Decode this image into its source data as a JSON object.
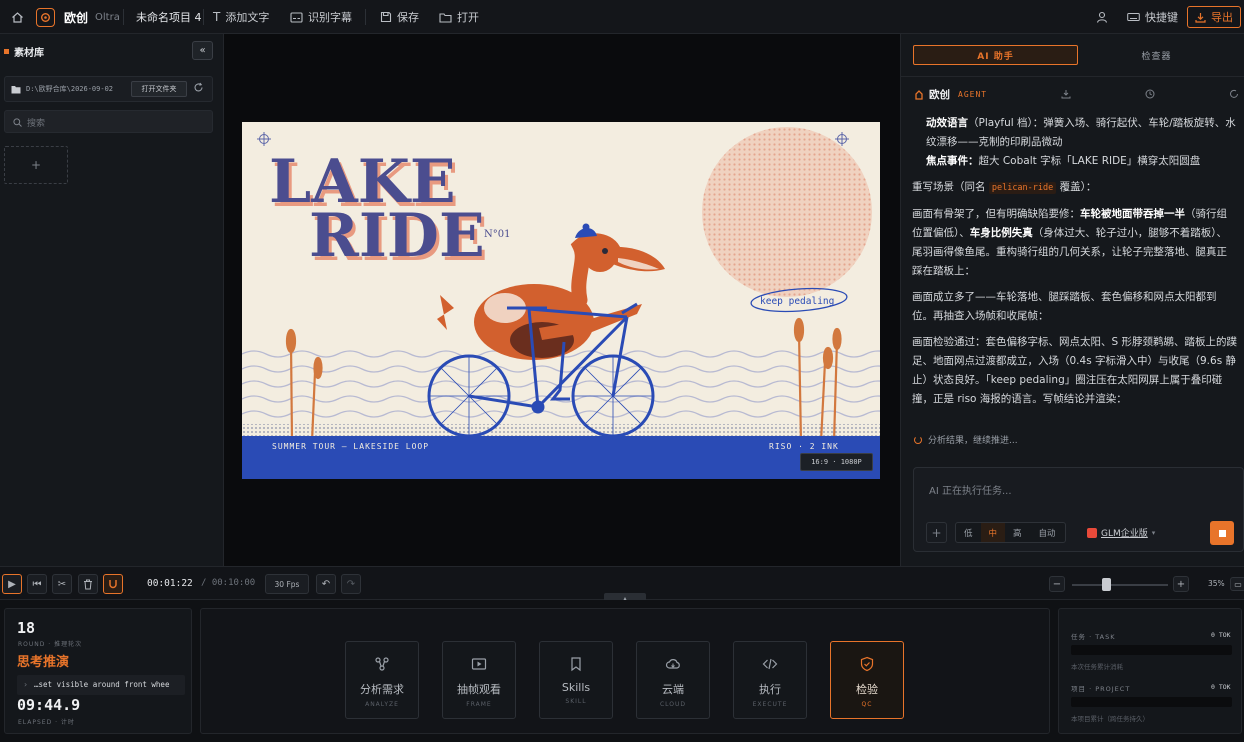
{
  "topbar": {
    "brand": "欧创",
    "brand_sub": "Oltra",
    "project": "未命名项目 4",
    "add_text": "添加文字",
    "subtitle": "识别字幕",
    "save": "保存",
    "open": "打开",
    "shortcuts": "快捷键",
    "export": "导出"
  },
  "library": {
    "title": "素材库",
    "path": "D:\\欧野合库\\2026-09-02",
    "open_folder": "打开文件夹",
    "search_placeholder": "搜索"
  },
  "poster": {
    "title_line1": "LAKE",
    "title_line2": "RIDE",
    "number": "N°01",
    "tag": "keep pedaling",
    "footer_left": "SUMMER TOUR — LAKESIDE LOOP",
    "footer_right": "RISO · 2 INK",
    "ratio": "16:9 · 1080P"
  },
  "assistant": {
    "tab_ai": "AI 助手",
    "tab_review": "检查器",
    "agent_name": "欧创",
    "agent_tag": "AGENT",
    "line1_label": "动效语言",
    "line1_text": "（Playful 档）：弹簧入场、骑行起伏、车轮/踏板旋转、水纹漂移——克制的印刷品微动",
    "line2_label": "焦点事件：",
    "line2_text": "超大 Cobalt 字标「LAKE RIDE」横穿太阳圆盘",
    "rewrite_pre": "重写场景（同名",
    "rewrite_code": "pelican-ride",
    "rewrite_post": "覆盖）：",
    "p2_a": "画面有骨架了，但有明确缺陷要修：",
    "p2_b": "车轮被地面带吞掉一半",
    "p2_c": "（骑行组位置偏低）、",
    "p2_d": "车身比例失真",
    "p2_e": "（身体过大、轮子过小，腿够不着踏板）、尾羽画得像鱼尾。重构骑行组的几何关系，让轮子完整落地、腿真正踩在踏板上：",
    "p3": "画面成立多了——车轮落地、腿踩踏板、套色偏移和网点太阳都到位。再抽查入场帧和收尾帧：",
    "p4": "画面检验通过：套色偏移字标、网点太阳、S 形脖颈鹈鹕、踏板上的蹼足、地面网点过渡都成立，入场（0.4s 字标滑入中）与收尾（9.6s 静止）状态良好。「keep pedaling」圈注压在太阳网屏上属于叠印碰撞，正是 riso 海报的语言。写帧结论并渲染：",
    "status": "分析结果，继续推进...",
    "input_placeholder": "AI 正在执行任务...",
    "levels": [
      "低",
      "中",
      "高",
      "自动"
    ],
    "level_selected": "中",
    "model": "GLM企业版"
  },
  "timeline": {
    "time_current": "00:01:22",
    "time_total": "/ 00:10:00",
    "fps": "30 Fps",
    "zoom": "35%"
  },
  "status_panel": {
    "round": "18",
    "round_label": "ROUND · 推理轮次",
    "title": "思考推演",
    "snippet": "…set visible around front whee",
    "elapsed": "09:44.9",
    "elapsed_label": "ELAPSED · 计时"
  },
  "workflow": [
    {
      "label": "分析需求",
      "sub": "ANALYZE"
    },
    {
      "label": "抽帧观看",
      "sub": "FRAME"
    },
    {
      "label": "Skills",
      "sub": "SKILL"
    },
    {
      "label": "云端",
      "sub": "CLOUD"
    },
    {
      "label": "执行",
      "sub": "EXECUTE"
    },
    {
      "label": "检验",
      "sub": "QC"
    }
  ],
  "token_panel": {
    "task_label": "任务 · TASK",
    "task_value": "0 TOK",
    "task_note": "本次任务累计消耗",
    "project_label": "项目 · PROJECT",
    "project_value": "0 TOK",
    "project_note": "本项目累计（跨任务持久）"
  },
  "colors": {
    "accent": "#e8742a",
    "cobalt": "#2a4bb5",
    "cream": "#f3ede0",
    "pelican": "#d2602e"
  }
}
